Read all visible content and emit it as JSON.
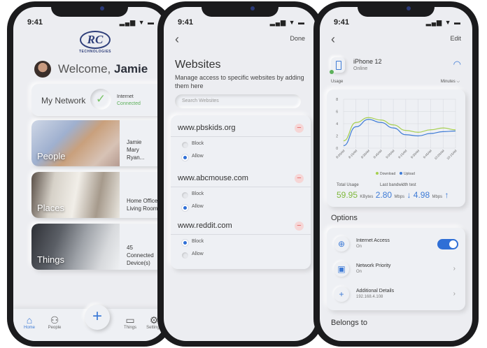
{
  "status": {
    "time": "9:41",
    "indicators": "▂▄▆ ▼ ▬"
  },
  "home": {
    "logo_letters": "RC",
    "logo_sub": "TECHNOLOGIES",
    "welcome_prefix": "Welcome,",
    "user_name": "Jamie",
    "network_label": "My Network",
    "internet_label": "Internet",
    "internet_status": "Connected",
    "categories": [
      {
        "name": "People",
        "details": [
          "Jamie",
          "Mary",
          "Ryan..."
        ],
        "icon": "people-icon"
      },
      {
        "name": "Places",
        "details": [
          "Home Office",
          "Living Room"
        ],
        "icon": "devices-icon"
      },
      {
        "name": "Things",
        "details": [
          "45",
          "Connected",
          "Device(s)"
        ],
        "icon": "devices-icon"
      }
    ],
    "tabs": [
      "Home",
      "People",
      "Things",
      "Settings"
    ]
  },
  "websites": {
    "done_label": "Done",
    "title": "Websites",
    "description": "Manage access to specific websites by adding them here",
    "search_placeholder": "Search Websites",
    "block_label": "Block",
    "allow_label": "Allow",
    "sites": [
      {
        "domain": "www.pbskids.org",
        "selected": "Allow"
      },
      {
        "domain": "www.abcmouse.com",
        "selected": "Allow"
      },
      {
        "domain": "www.reddit.com",
        "selected": "Block"
      }
    ]
  },
  "device": {
    "edit_label": "Edit",
    "name": "iPhone 12",
    "status": "Online",
    "usage_label": "Usage",
    "period": "Minutes",
    "total_usage_label": "Total Usage",
    "total_usage_value": "59.95",
    "total_usage_unit": "KBytes",
    "bandwidth_label": "Last bandwidth test",
    "download_value": "2.80",
    "upload_value": "4.98",
    "speed_unit": "Mbps",
    "options_title": "Options",
    "options": [
      {
        "title": "Internet Access",
        "sub": "On",
        "control": "toggle",
        "value": true
      },
      {
        "title": "Network Priority",
        "sub": "On",
        "control": "chevron"
      },
      {
        "title": "Additional Details",
        "sub": "192.168.4.108",
        "control": "chevron"
      }
    ],
    "belongs_title": "Belongs to",
    "colors": {
      "download": "#a6cf4f",
      "upload": "#3e7bd6",
      "accent": "#2f6fd6"
    }
  },
  "chart_data": {
    "type": "line",
    "categories": [
      "8:00AM",
      "8:15AM",
      "8:30AM",
      "8:45AM",
      "9:00AM",
      "9:15AM",
      "9:30AM",
      "9:45AM",
      "10:00AM",
      "10:15AM"
    ],
    "series": [
      {
        "name": "Download",
        "values": [
          1.2,
          4.2,
          5.0,
          4.6,
          3.8,
          2.9,
          2.6,
          3.0,
          3.3,
          3.0
        ]
      },
      {
        "name": "Upload",
        "values": [
          0.4,
          3.5,
          4.7,
          4.2,
          3.3,
          2.2,
          2.0,
          2.4,
          2.7,
          2.8
        ]
      }
    ],
    "ylim": [
      0,
      8
    ],
    "yticks": [
      "0",
      "2",
      "4",
      "6",
      "8"
    ],
    "legend": "bottom",
    "grid": true
  }
}
